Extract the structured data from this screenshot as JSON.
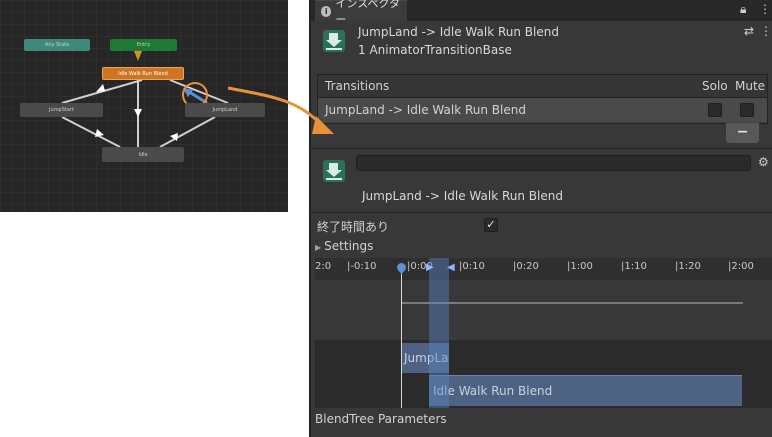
{
  "animator": {
    "nodes": {
      "any_state": "Any State",
      "entry": "Entry",
      "blend": "Idle Walk Run Blend",
      "jump_start": "JumpStart",
      "jump_land": "JumpLand",
      "idle": "Idle"
    }
  },
  "inspector": {
    "tab_label": "インスペクター",
    "header_title": "JumpLand -> Idle Walk Run Blend",
    "header_subtitle": "1 AnimatorTransitionBase",
    "transitions": {
      "heading": "Transitions",
      "solo": "Solo",
      "mute": "Mute",
      "row_label": "JumpLand -> Idle Walk Run Blend",
      "remove_button": "−"
    },
    "transition_name_field": "",
    "transition_title": "JumpLand -> Idle Walk Run Blend",
    "has_exit_time_label": "終了時間あり",
    "has_exit_time_checked": true,
    "settings_label": "Settings",
    "timeline": {
      "ticks": [
        "|0:00",
        "|0:10",
        "|0:20",
        "|1:00",
        "|1:10",
        "|1:20",
        "|2:00"
      ],
      "left_partial": "0:10",
      "left_edge": "2:0",
      "track_from": "JumpLa",
      "track_to": "Idle Walk Run Blend"
    },
    "blendtree_label": "BlendTree Parameters"
  },
  "colors": {
    "accent_orange": "#e8903a",
    "blend_node": "#cf7522",
    "entry_node": "#1e7a33",
    "any_state_node": "#3d8a7a"
  }
}
